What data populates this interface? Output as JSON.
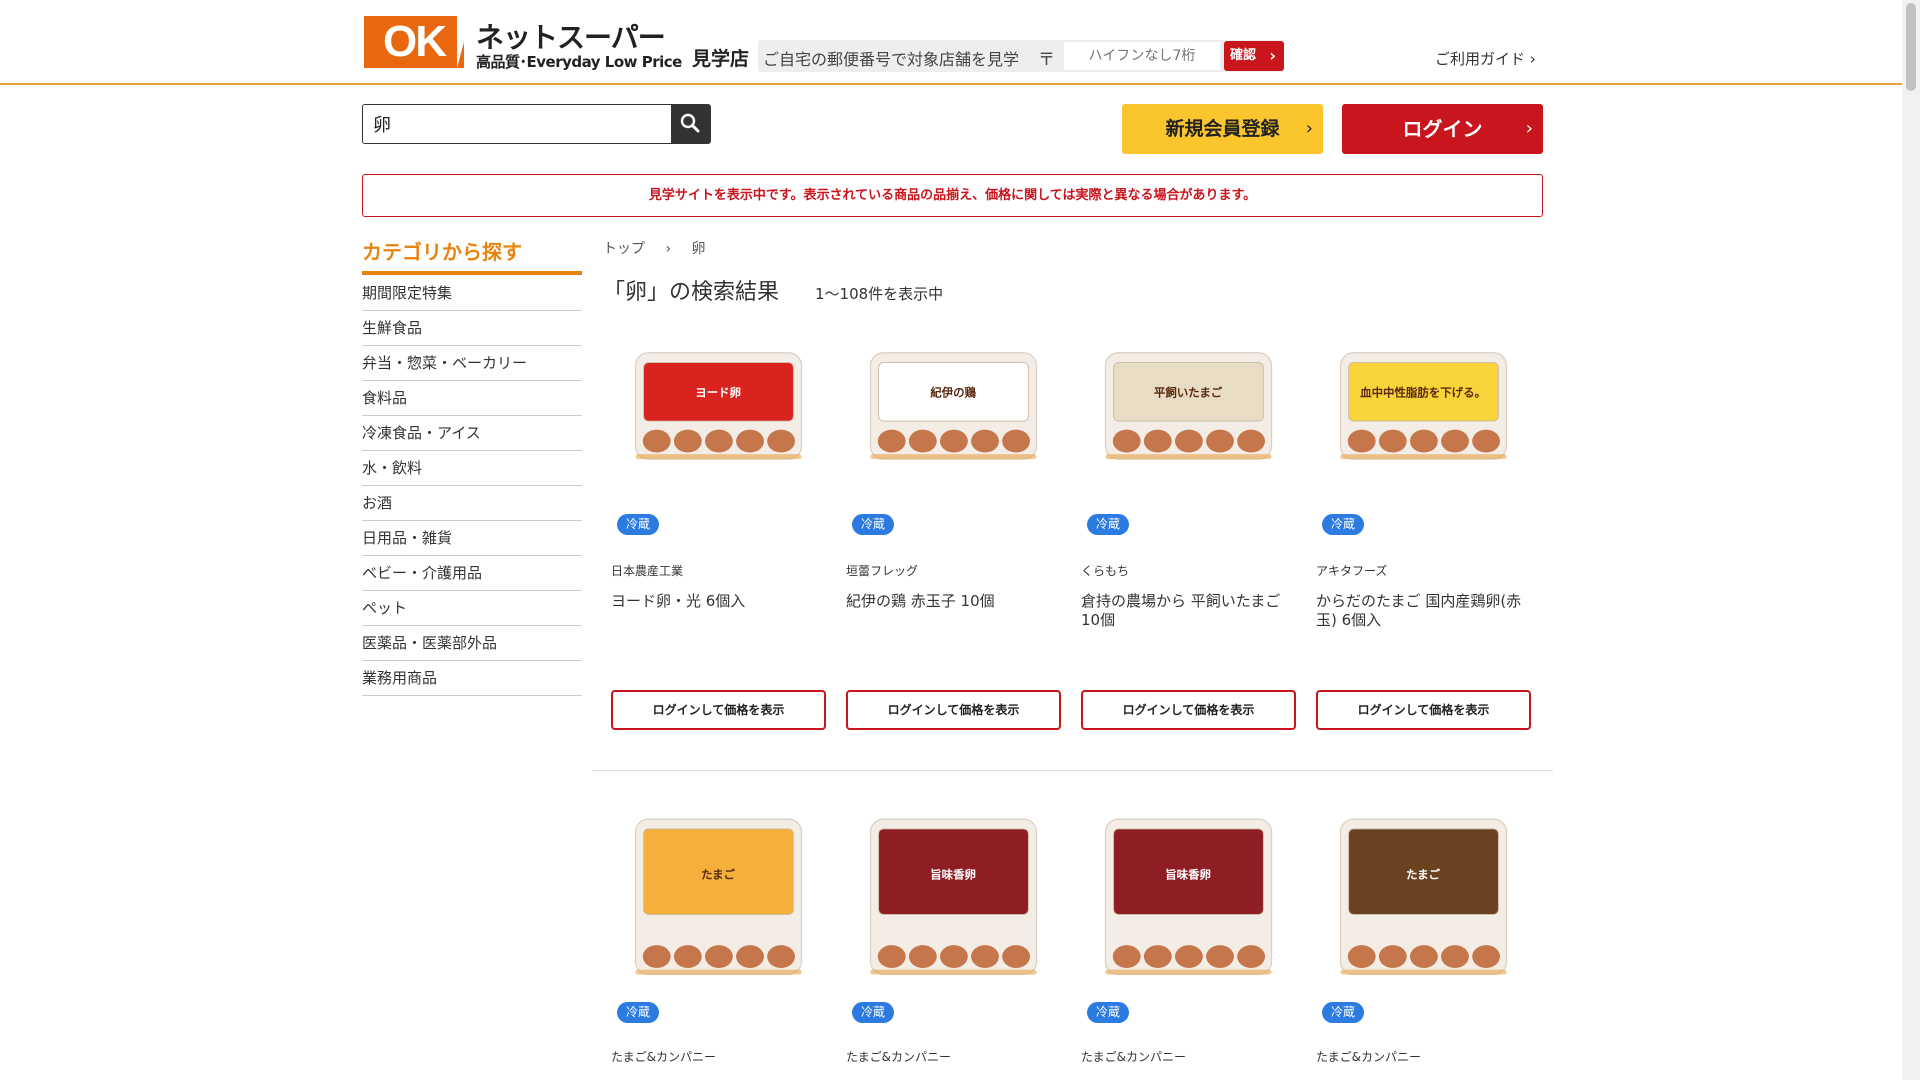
{
  "header": {
    "logo_mark": "OK",
    "logo_title": "ネットスーパー",
    "logo_sub": "高品質･Everyday Low Price",
    "store_label": "見学店",
    "postal_prompt": "ご自宅の郵便番号で対象店舗を見学",
    "postal_mark": "〒",
    "postal_placeholder": "ハイフンなし7桁",
    "confirm_label": "確認",
    "guide_label": "ご利用ガイド ›"
  },
  "search": {
    "value": "卵"
  },
  "actions": {
    "register_label": "新規会員登録",
    "login_label": "ログイン",
    "chevron": "›"
  },
  "notice": "見学サイトを表示中です。表示されている商品の品揃え、価格に関しては実際と異なる場合があります。",
  "sidebar": {
    "title": "カテゴリから探す",
    "items": [
      "期間限定特集",
      "生鮮食品",
      "弁当・惣菜・ベーカリー",
      "食料品",
      "冷凍食品・アイス",
      "水・飲料",
      "お酒",
      "日用品・雑貨",
      "ベビー・介護用品",
      "ペット",
      "医薬品・医薬部外品",
      "業務用商品"
    ]
  },
  "breadcrumb": {
    "home": "トップ",
    "sep": "›",
    "current": "卵"
  },
  "results": {
    "title": "「卵」の検索結果",
    "count": "1～108件を表示中"
  },
  "products": [
    {
      "badge": "冷蔵",
      "maker": "日本農産工業",
      "name": "ヨード卵・光 6個入",
      "button": "ログインして価格を表示",
      "label_color": "#d8231e",
      "label_text": "ヨード卵"
    },
    {
      "badge": "冷蔵",
      "maker": "垣蕾フレッグ",
      "name": "紀伊の鶏 赤玉子 10個",
      "button": "ログインして価格を表示",
      "label_color": "#ffffff",
      "label_text": "紀伊の鶏"
    },
    {
      "badge": "冷蔵",
      "maker": "くらもち",
      "name": "倉持の農場から 平飼いたまご 10個",
      "button": "ログインして価格を表示",
      "label_color": "#e8dcc4",
      "label_text": "平飼いたまご"
    },
    {
      "badge": "冷蔵",
      "maker": "アキタフーズ",
      "name": "からだのたまご 国内産鶏卵(赤玉) 6個入",
      "button": "ログインして価格を表示",
      "label_color": "#f7d43a",
      "label_text": "血中中性脂肪を下げる。"
    },
    {
      "badge": "冷蔵",
      "maker": "たまご&カンパニー",
      "label_color": "#f4b03a",
      "label_text": "たまご"
    },
    {
      "badge": "冷蔵",
      "maker": "たまご&カンパニー",
      "label_color": "#8e1d24",
      "label_text": "旨味香卵"
    },
    {
      "badge": "冷蔵",
      "maker": "たまご&カンパニー",
      "label_color": "#8e1d24",
      "label_text": "旨味香卵"
    },
    {
      "badge": "冷蔵",
      "maker": "たまご&カンパニー",
      "label_color": "#6b4220",
      "label_text": "たまご"
    }
  ]
}
